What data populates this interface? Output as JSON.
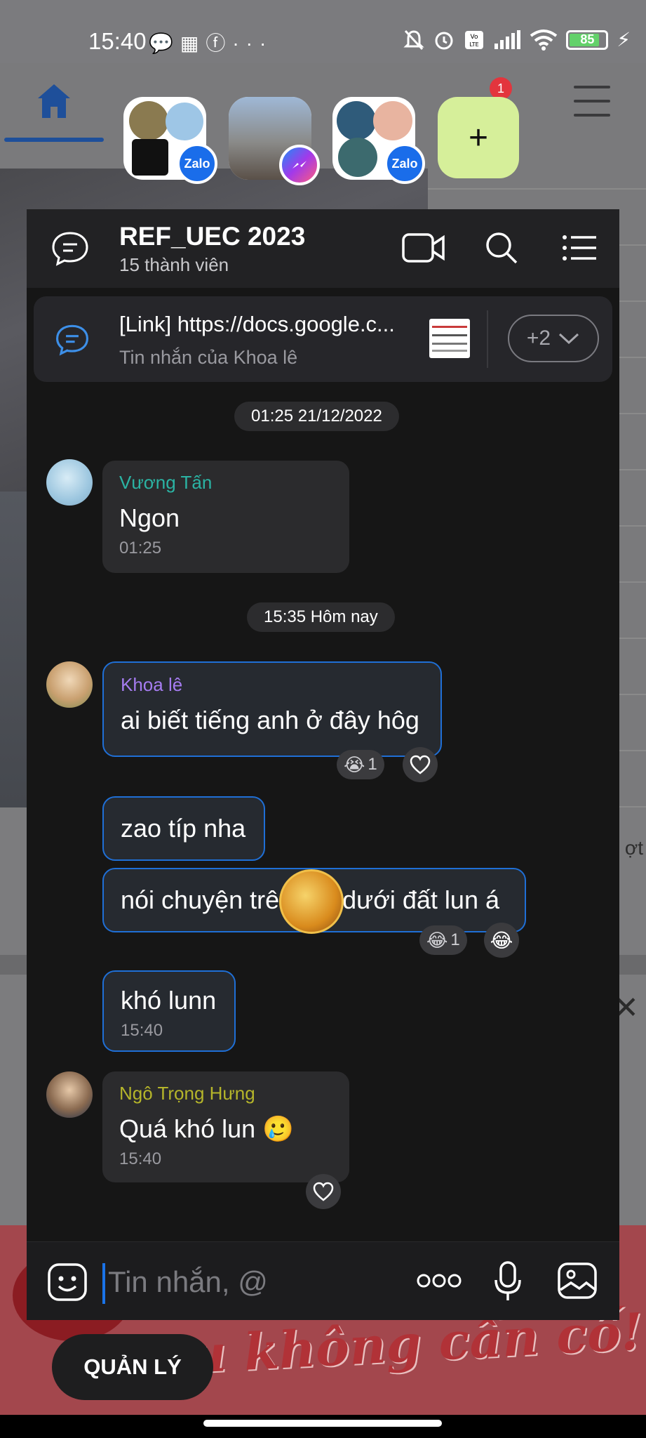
{
  "status_bar": {
    "time": "15:40",
    "left_icons": [
      "chat-bubble-icon",
      "grid-app-icon",
      "facebook-icon",
      "more-dots-icon"
    ],
    "right_icons": [
      "bell-off-icon",
      "alarm-icon",
      "volte-icon",
      "signal-icon",
      "wifi-icon",
      "battery-icon",
      "charging-icon"
    ],
    "battery_level": "85",
    "volte_label": "Vo\nLTE"
  },
  "background": {
    "notification_count": "1",
    "partial_text_right": "ợt",
    "ad_text": "u không cần cố!"
  },
  "bubble_heads": [
    {
      "name": "group-bubble-1",
      "app": "Zalo"
    },
    {
      "name": "group-bubble-2",
      "app": "Messenger"
    },
    {
      "name": "group-bubble-3",
      "app": "Zalo"
    }
  ],
  "add_bubble_label": "+",
  "chat": {
    "title": "REF_UEC 2023",
    "subtitle": "15 thành viên",
    "pinned": {
      "title": "[Link] https://docs.google.c...",
      "subtitle": "Tin nhắn của Khoa lê",
      "more_count": "+2"
    },
    "date_separators": [
      "01:25 21/12/2022",
      "15:35 Hôm nay"
    ],
    "messages": [
      {
        "sender": "Vương Tấn",
        "sender_color": "#2bb3a3",
        "text": "Ngon",
        "time": "01:25"
      },
      {
        "sender": "Khoa lê",
        "sender_color": "#a57cf0",
        "text": "ai biết tiếng anh ở đây hôg",
        "reaction_count": "1"
      },
      {
        "text": "zao típ nha"
      },
      {
        "text_before": "nói chuyện trê",
        "text_after": " dưới đất lun á",
        "reaction_count": "1"
      },
      {
        "text": "khó lunn",
        "time": "15:40"
      },
      {
        "sender": "Ngô Trọng Hưng",
        "sender_color": "#b5b52a",
        "text": "Quá khó lun 🥲",
        "time": "15:40"
      }
    ],
    "input": {
      "placeholder": "Tin nhắn, @"
    }
  },
  "manage_button": "QUẢN LÝ",
  "colors": {
    "accent_blue": "#1a73e8",
    "add_bubble": "#d6ef9a",
    "panel_bg": "#161616",
    "bubble_bg": "#2b2b2d"
  }
}
